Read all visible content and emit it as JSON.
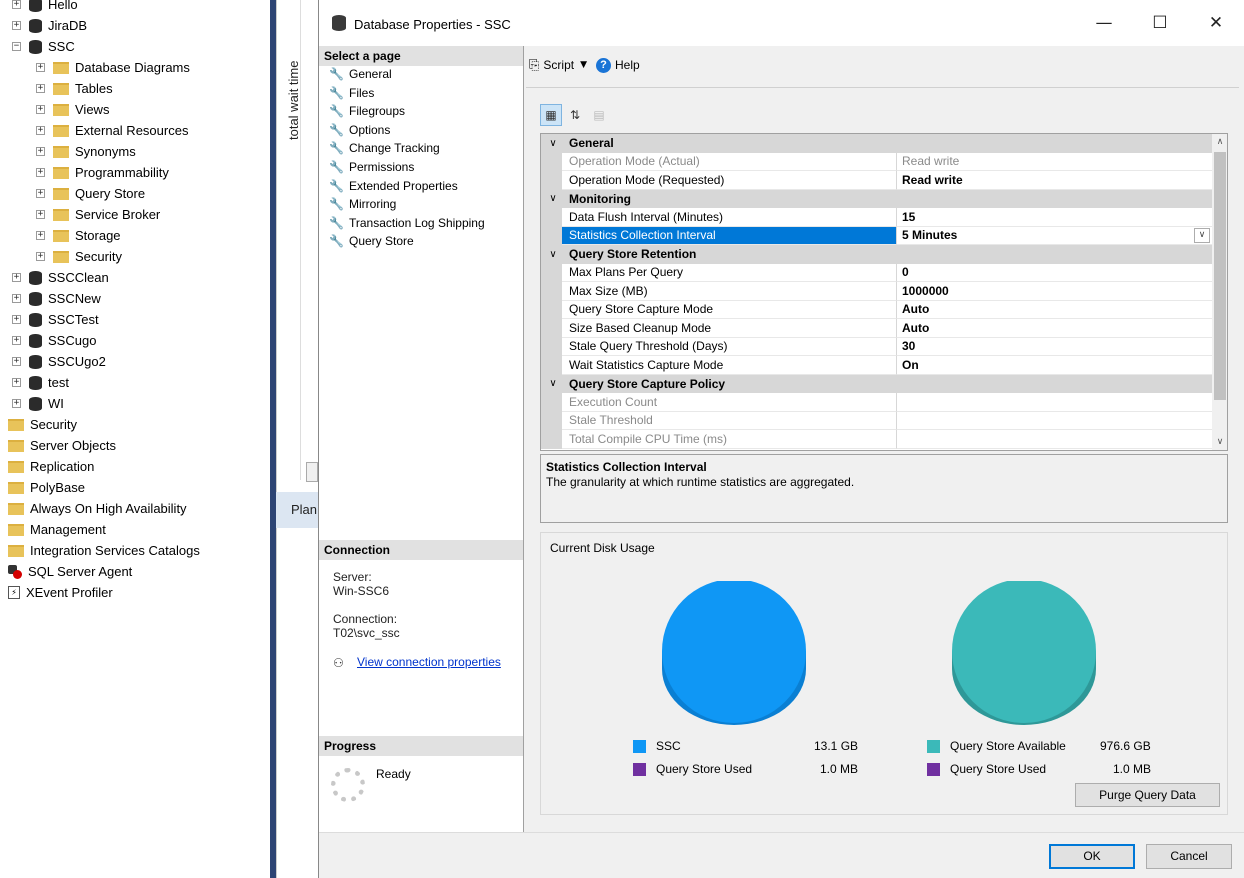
{
  "object_explorer": {
    "items": [
      {
        "label": "Hello",
        "expander": "+",
        "icon": "database-icon",
        "indent": 1
      },
      {
        "label": "JiraDB",
        "expander": "+",
        "icon": "database-icon",
        "indent": 1
      },
      {
        "label": "SSC",
        "expander": "−",
        "icon": "database-icon",
        "indent": 1
      },
      {
        "label": "Database Diagrams",
        "expander": "+",
        "icon": "folder-icon",
        "indent": 2
      },
      {
        "label": "Tables",
        "expander": "+",
        "icon": "folder-icon",
        "indent": 2
      },
      {
        "label": "Views",
        "expander": "+",
        "icon": "folder-icon",
        "indent": 2
      },
      {
        "label": "External Resources",
        "expander": "+",
        "icon": "folder-icon",
        "indent": 2
      },
      {
        "label": "Synonyms",
        "expander": "+",
        "icon": "folder-icon",
        "indent": 2
      },
      {
        "label": "Programmability",
        "expander": "+",
        "icon": "folder-icon",
        "indent": 2
      },
      {
        "label": "Query Store",
        "expander": "+",
        "icon": "folder-icon",
        "indent": 2
      },
      {
        "label": "Service Broker",
        "expander": "+",
        "icon": "folder-icon",
        "indent": 2
      },
      {
        "label": "Storage",
        "expander": "+",
        "icon": "folder-icon",
        "indent": 2
      },
      {
        "label": "Security",
        "expander": "+",
        "icon": "folder-icon",
        "indent": 2
      },
      {
        "label": "SSCClean",
        "expander": "+",
        "icon": "database-icon",
        "indent": 1
      },
      {
        "label": "SSCNew",
        "expander": "+",
        "icon": "database-icon",
        "indent": 1
      },
      {
        "label": "SSCTest",
        "expander": "+",
        "icon": "database-icon",
        "indent": 1
      },
      {
        "label": "SSCugo",
        "expander": "+",
        "icon": "database-icon",
        "indent": 1
      },
      {
        "label": "SSCUgo2",
        "expander": "+",
        "icon": "database-icon",
        "indent": 1
      },
      {
        "label": "test",
        "expander": "+",
        "icon": "database-icon",
        "indent": 1
      },
      {
        "label": "WI",
        "expander": "+",
        "icon": "database-icon",
        "indent": 1
      },
      {
        "label": "Security",
        "expander": "",
        "icon": "folder-icon",
        "indent": 0
      },
      {
        "label": "Server Objects",
        "expander": "",
        "icon": "folder-icon",
        "indent": 0
      },
      {
        "label": "Replication",
        "expander": "",
        "icon": "folder-icon",
        "indent": 0
      },
      {
        "label": "PolyBase",
        "expander": "",
        "icon": "folder-icon",
        "indent": 0
      },
      {
        "label": "Always On High Availability",
        "expander": "",
        "icon": "folder-icon",
        "indent": 0
      },
      {
        "label": "Management",
        "expander": "",
        "icon": "folder-icon",
        "indent": 0
      },
      {
        "label": "Integration Services Catalogs",
        "expander": "",
        "icon": "folder-icon",
        "indent": 0
      },
      {
        "label": "SQL Server Agent",
        "expander": "",
        "icon": "agent-icon",
        "indent": 0
      },
      {
        "label": "XEvent Profiler",
        "expander": "",
        "icon": "xevent-icon",
        "indent": 0
      }
    ]
  },
  "background": {
    "vertical_label": "total wait time",
    "tab_label": "Plan"
  },
  "dialog": {
    "title": "Database Properties - SSC",
    "window_controls": {
      "minimize": "—",
      "maximize": "☐",
      "close": "✕"
    },
    "select_page_header": "Select a page",
    "pages": [
      "General",
      "Files",
      "Filegroups",
      "Options",
      "Change Tracking",
      "Permissions",
      "Extended Properties",
      "Mirroring",
      "Transaction Log Shipping",
      "Query Store"
    ],
    "connection_header": "Connection",
    "server_label": "Server:",
    "server_value": "Win-SSC6",
    "connection_label": "Connection:",
    "connection_value": "T02\\svc_ssc",
    "view_connection_link": "View connection properties",
    "progress_header": "Progress",
    "progress_status": "Ready",
    "toolbar": {
      "script_label": "Script",
      "help_label": "Help"
    },
    "property_grid": {
      "rows": [
        {
          "kind": "category",
          "name": "General"
        },
        {
          "kind": "prop",
          "name": "Operation Mode (Actual)",
          "value": "Read write",
          "readonly": true
        },
        {
          "kind": "prop",
          "name": "Operation Mode (Requested)",
          "value": "Read write"
        },
        {
          "kind": "category",
          "name": "Monitoring"
        },
        {
          "kind": "prop",
          "name": "Data Flush Interval (Minutes)",
          "value": "15"
        },
        {
          "kind": "prop",
          "name": "Statistics Collection Interval",
          "value": "5 Minutes",
          "selected": true
        },
        {
          "kind": "category",
          "name": "Query Store Retention"
        },
        {
          "kind": "prop",
          "name": "Max Plans Per Query",
          "value": "0"
        },
        {
          "kind": "prop",
          "name": "Max Size (MB)",
          "value": "1000000"
        },
        {
          "kind": "prop",
          "name": "Query Store Capture Mode",
          "value": "Auto"
        },
        {
          "kind": "prop",
          "name": "Size Based Cleanup Mode",
          "value": "Auto"
        },
        {
          "kind": "prop",
          "name": "Stale Query Threshold (Days)",
          "value": "30"
        },
        {
          "kind": "prop",
          "name": "Wait Statistics Capture Mode",
          "value": "On"
        },
        {
          "kind": "category",
          "name": "Query Store Capture Policy"
        },
        {
          "kind": "prop",
          "name": "Execution Count",
          "value": "",
          "readonly": true
        },
        {
          "kind": "prop",
          "name": "Stale Threshold",
          "value": "",
          "readonly": true
        },
        {
          "kind": "prop",
          "name": "Total Compile CPU Time (ms)",
          "value": "",
          "readonly": true
        }
      ]
    },
    "description": {
      "title": "Statistics Collection Interval",
      "body": "The granularity at which runtime statistics are aggregated."
    },
    "disk_usage": {
      "title": "Current Disk Usage",
      "left_legend": [
        {
          "label": "SSC",
          "value": "13.1 GB",
          "color": "#0f97f5"
        },
        {
          "label": "Query Store Used",
          "value": "1.0 MB",
          "color": "#7030a0"
        }
      ],
      "right_legend": [
        {
          "label": "Query Store Available",
          "value": "976.6 GB",
          "color": "#3bb9b9"
        },
        {
          "label": "Query Store Used",
          "value": "1.0 MB",
          "color": "#7030a0"
        }
      ],
      "purge_button": "Purge Query Data"
    },
    "ok_button": "OK",
    "cancel_button": "Cancel"
  }
}
